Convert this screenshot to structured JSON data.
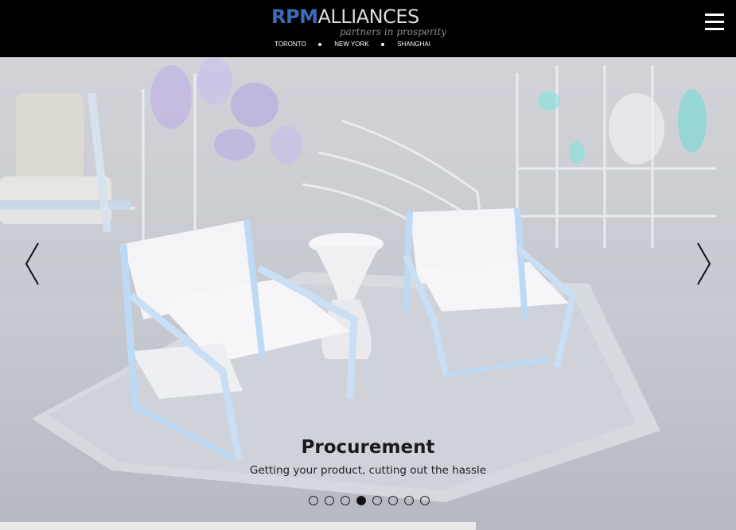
{
  "header": {
    "logo": {
      "brand_rpm": "RPM",
      "brand_alliances": "ALLIANCES",
      "tagline": "partners in prosperity",
      "cities": [
        "TORONTO",
        "NEW YORK",
        "SHANGHAI"
      ]
    },
    "menu_icon": "hamburger-menu-icon"
  },
  "slider": {
    "caption_title": "Procurement",
    "caption_subtitle": "Getting your product, cutting out the hassle",
    "prev_icon": "chevron-left-icon",
    "next_icon": "chevron-right-icon",
    "dots_total": 8,
    "active_dot": 4
  },
  "colors": {
    "header_bg": "#000000",
    "brand_blue": "#3b6bb5"
  }
}
